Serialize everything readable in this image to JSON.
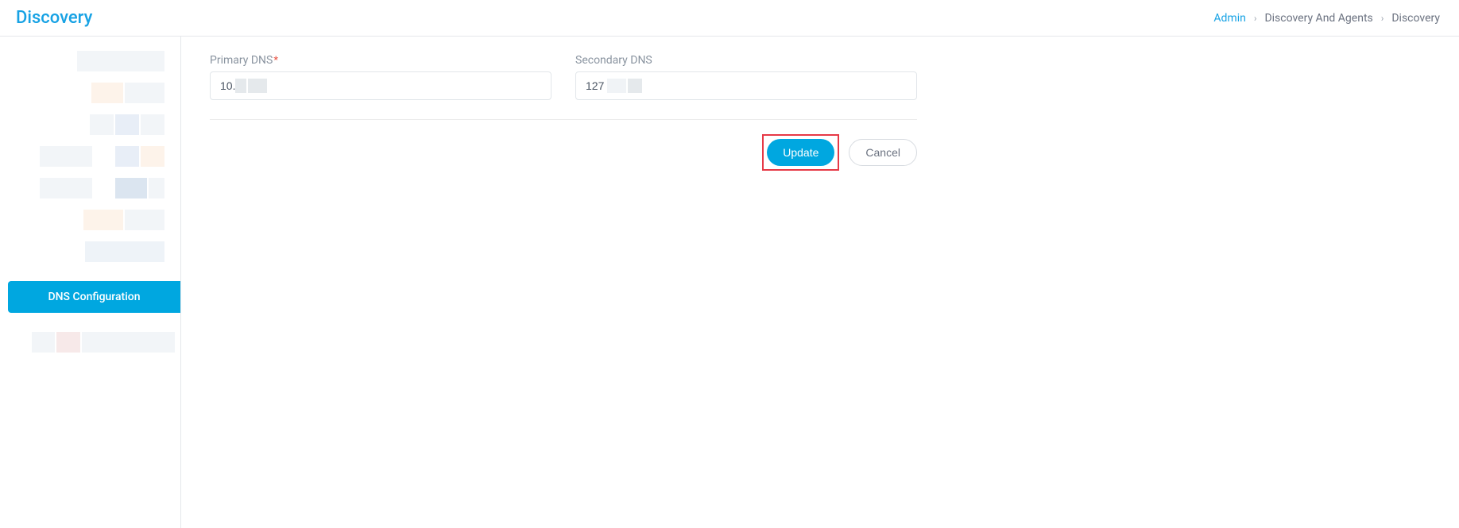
{
  "header": {
    "title": "Discovery"
  },
  "breadcrumb": {
    "admin": "Admin",
    "level1": "Discovery And Agents",
    "level2": "Discovery"
  },
  "sidebar": {
    "active_item": "DNS Configuration"
  },
  "form": {
    "primary_dns": {
      "label": "Primary DNS",
      "value": "10."
    },
    "secondary_dns": {
      "label": "Secondary DNS",
      "value": "127"
    }
  },
  "buttons": {
    "update": "Update",
    "cancel": "Cancel"
  }
}
